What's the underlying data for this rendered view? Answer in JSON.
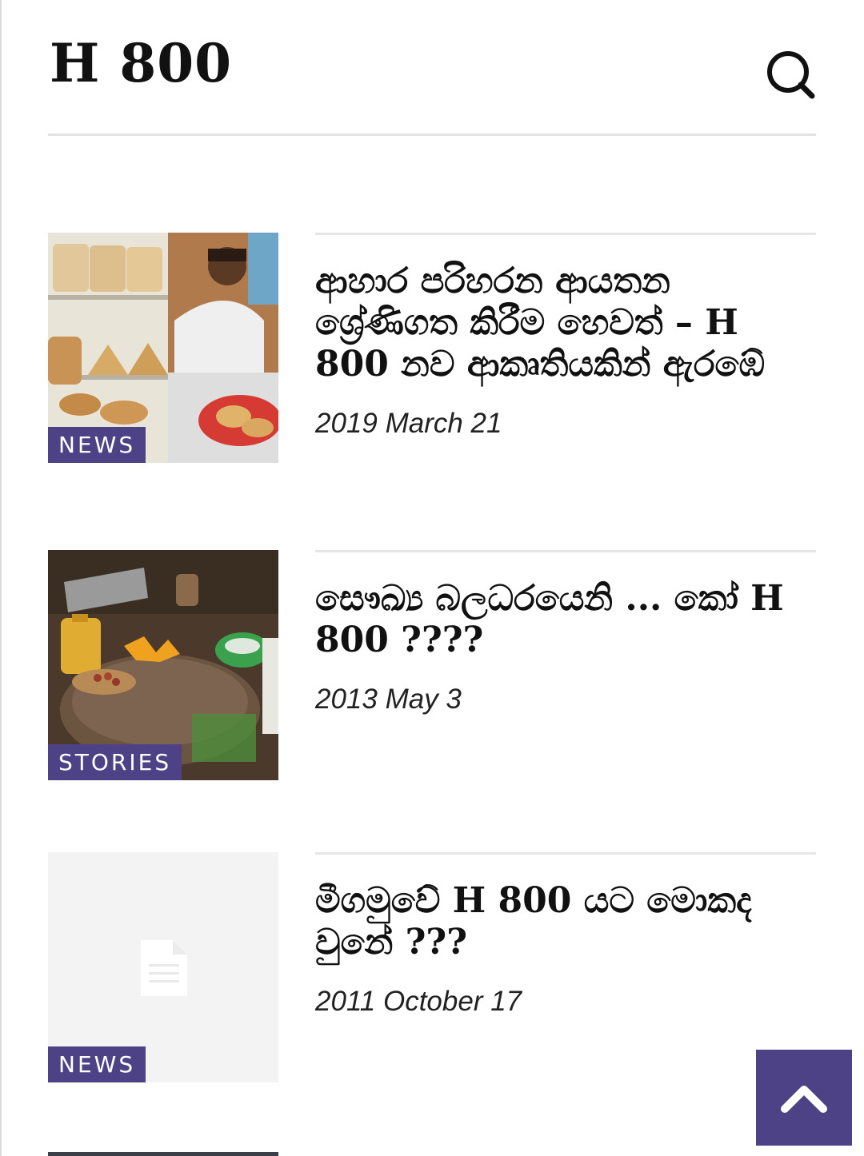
{
  "header": {
    "site_title": "H 800",
    "search_icon": "search-icon"
  },
  "articles": [
    {
      "category": "NEWS",
      "title": "ආහාර පරිහරන ආයතන ශ්‍රේණිගත කිරීම හෙවත් – H 800 නව ආකෘතියකින් ඇරඹේ",
      "date": "2019 March 21"
    },
    {
      "category": "STORIES",
      "title": "සෞඛ්‍ය බලධරයෙනි ... කෝ H 800 ????",
      "date": "2013 May 3"
    },
    {
      "category": "NEWS",
      "title": "මීගමුවේ H 800 යට මොකද වුනේ ???",
      "date": "2011 October 17",
      "thumbnail_icon": "document-icon"
    }
  ],
  "controls": {
    "scroll_top_icon": "chevron-up-icon"
  },
  "colors": {
    "accent": "#4e4287",
    "rule": "#e3e3e3"
  }
}
